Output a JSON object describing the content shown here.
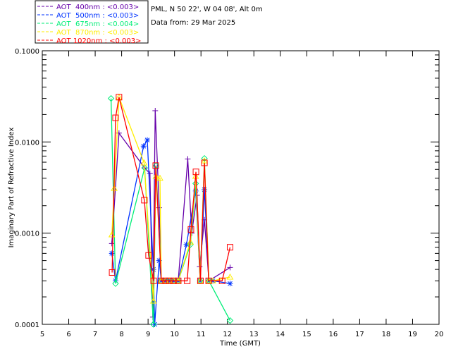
{
  "chart_data": {
    "type": "line",
    "title": "",
    "header_lines": [
      "PML, N 50 22', W 04 08', Alt 0m",
      "Data from: 29 Mar 2025"
    ],
    "xlabel": "Time (GMT)",
    "ylabel": "Imaginary Part of Refractive Index",
    "xlim": [
      5,
      20
    ],
    "ylim": [
      0.0001,
      0.1
    ],
    "yscale": "log",
    "xticks": [
      "5",
      "6",
      "7",
      "8",
      "9",
      "10",
      "11",
      "12",
      "13",
      "14",
      "15",
      "16",
      "17",
      "18",
      "19",
      "20"
    ],
    "yticks": [
      "0.0001",
      "0.0010",
      "0.0100",
      "0.1000"
    ],
    "grid": false,
    "legend_position": "top-left",
    "series": [
      {
        "name": "AOT  400nm : <0.003>",
        "color": "#6600aa",
        "marker": "plus",
        "x": [
          7.63,
          7.9,
          8.87,
          9.07,
          9.18,
          9.27,
          9.42,
          9.5,
          9.66,
          9.8,
          9.96,
          10.14,
          10.5,
          10.65,
          10.85,
          10.95,
          11.13,
          11.3,
          12.1
        ],
        "y": [
          0.00077,
          0.0125,
          0.0052,
          0.0045,
          0.00012,
          0.022,
          0.0019,
          0.0003,
          0.0003,
          0.0003,
          0.0003,
          0.0003,
          0.0065,
          0.001,
          0.0026,
          0.00043,
          0.0014,
          0.0003,
          0.00042
        ]
      },
      {
        "name": "AOT  500nm : <0.003>",
        "color": "#0033ff",
        "marker": "asterisk",
        "x": [
          7.63,
          7.77,
          8.83,
          8.97,
          9.2,
          9.25,
          9.42,
          9.5,
          9.66,
          9.8,
          9.96,
          10.14,
          10.45,
          10.8,
          10.97,
          11.13,
          11.3,
          11.45,
          12.1
        ],
        "y": [
          0.0006,
          0.0003,
          0.009,
          0.0105,
          0.0004,
          0.0001,
          0.0005,
          0.0003,
          0.0003,
          0.0003,
          0.0003,
          0.0003,
          0.00075,
          0.0029,
          0.0003,
          0.003,
          0.0003,
          0.0003,
          0.00028
        ]
      },
      {
        "name": "AOT  675nm : <0.004>",
        "color": "#00ee77",
        "marker": "diamond",
        "x": [
          7.6,
          7.77,
          8.87,
          9.2,
          9.3,
          9.5,
          9.66,
          9.8,
          9.96,
          10.14,
          10.6,
          10.8,
          10.97,
          11.13,
          11.3,
          12.1
        ],
        "y": [
          0.03,
          0.00028,
          0.0052,
          0.0001,
          0.0055,
          0.0003,
          0.0003,
          0.0003,
          0.0003,
          0.0003,
          0.00075,
          0.0035,
          0.0003,
          0.0066,
          0.0003,
          0.00011
        ]
      },
      {
        "name": "AOT  870nm : <0.003>",
        "color": "#ffee00",
        "marker": "triangle",
        "x": [
          7.63,
          7.72,
          7.9,
          8.85,
          9.2,
          9.3,
          9.45,
          9.5,
          9.66,
          9.8,
          9.96,
          10.14,
          10.6,
          10.8,
          10.97,
          11.13,
          11.3,
          11.45,
          12.1
        ],
        "y": [
          0.00096,
          0.0031,
          0.031,
          0.0059,
          0.00018,
          0.0042,
          0.004,
          0.0003,
          0.0003,
          0.0003,
          0.0003,
          0.0003,
          0.0008,
          0.0042,
          0.0003,
          0.0062,
          0.0003,
          0.0003,
          0.00033
        ]
      },
      {
        "name": "AOT 1020nm : <0.003>",
        "color": "#ff0000",
        "marker": "square",
        "x": [
          7.64,
          7.77,
          7.9,
          8.86,
          9.02,
          9.21,
          9.29,
          9.5,
          9.66,
          9.8,
          9.96,
          10.14,
          10.48,
          10.62,
          10.81,
          10.98,
          11.13,
          11.29,
          11.8,
          12.1
        ],
        "y": [
          0.00037,
          0.0184,
          0.031,
          0.0023,
          0.00057,
          0.0003,
          0.0055,
          0.0003,
          0.0003,
          0.0003,
          0.0003,
          0.0003,
          0.0003,
          0.0011,
          0.0047,
          0.0003,
          0.0059,
          0.0003,
          0.0003,
          0.0007
        ]
      }
    ]
  }
}
